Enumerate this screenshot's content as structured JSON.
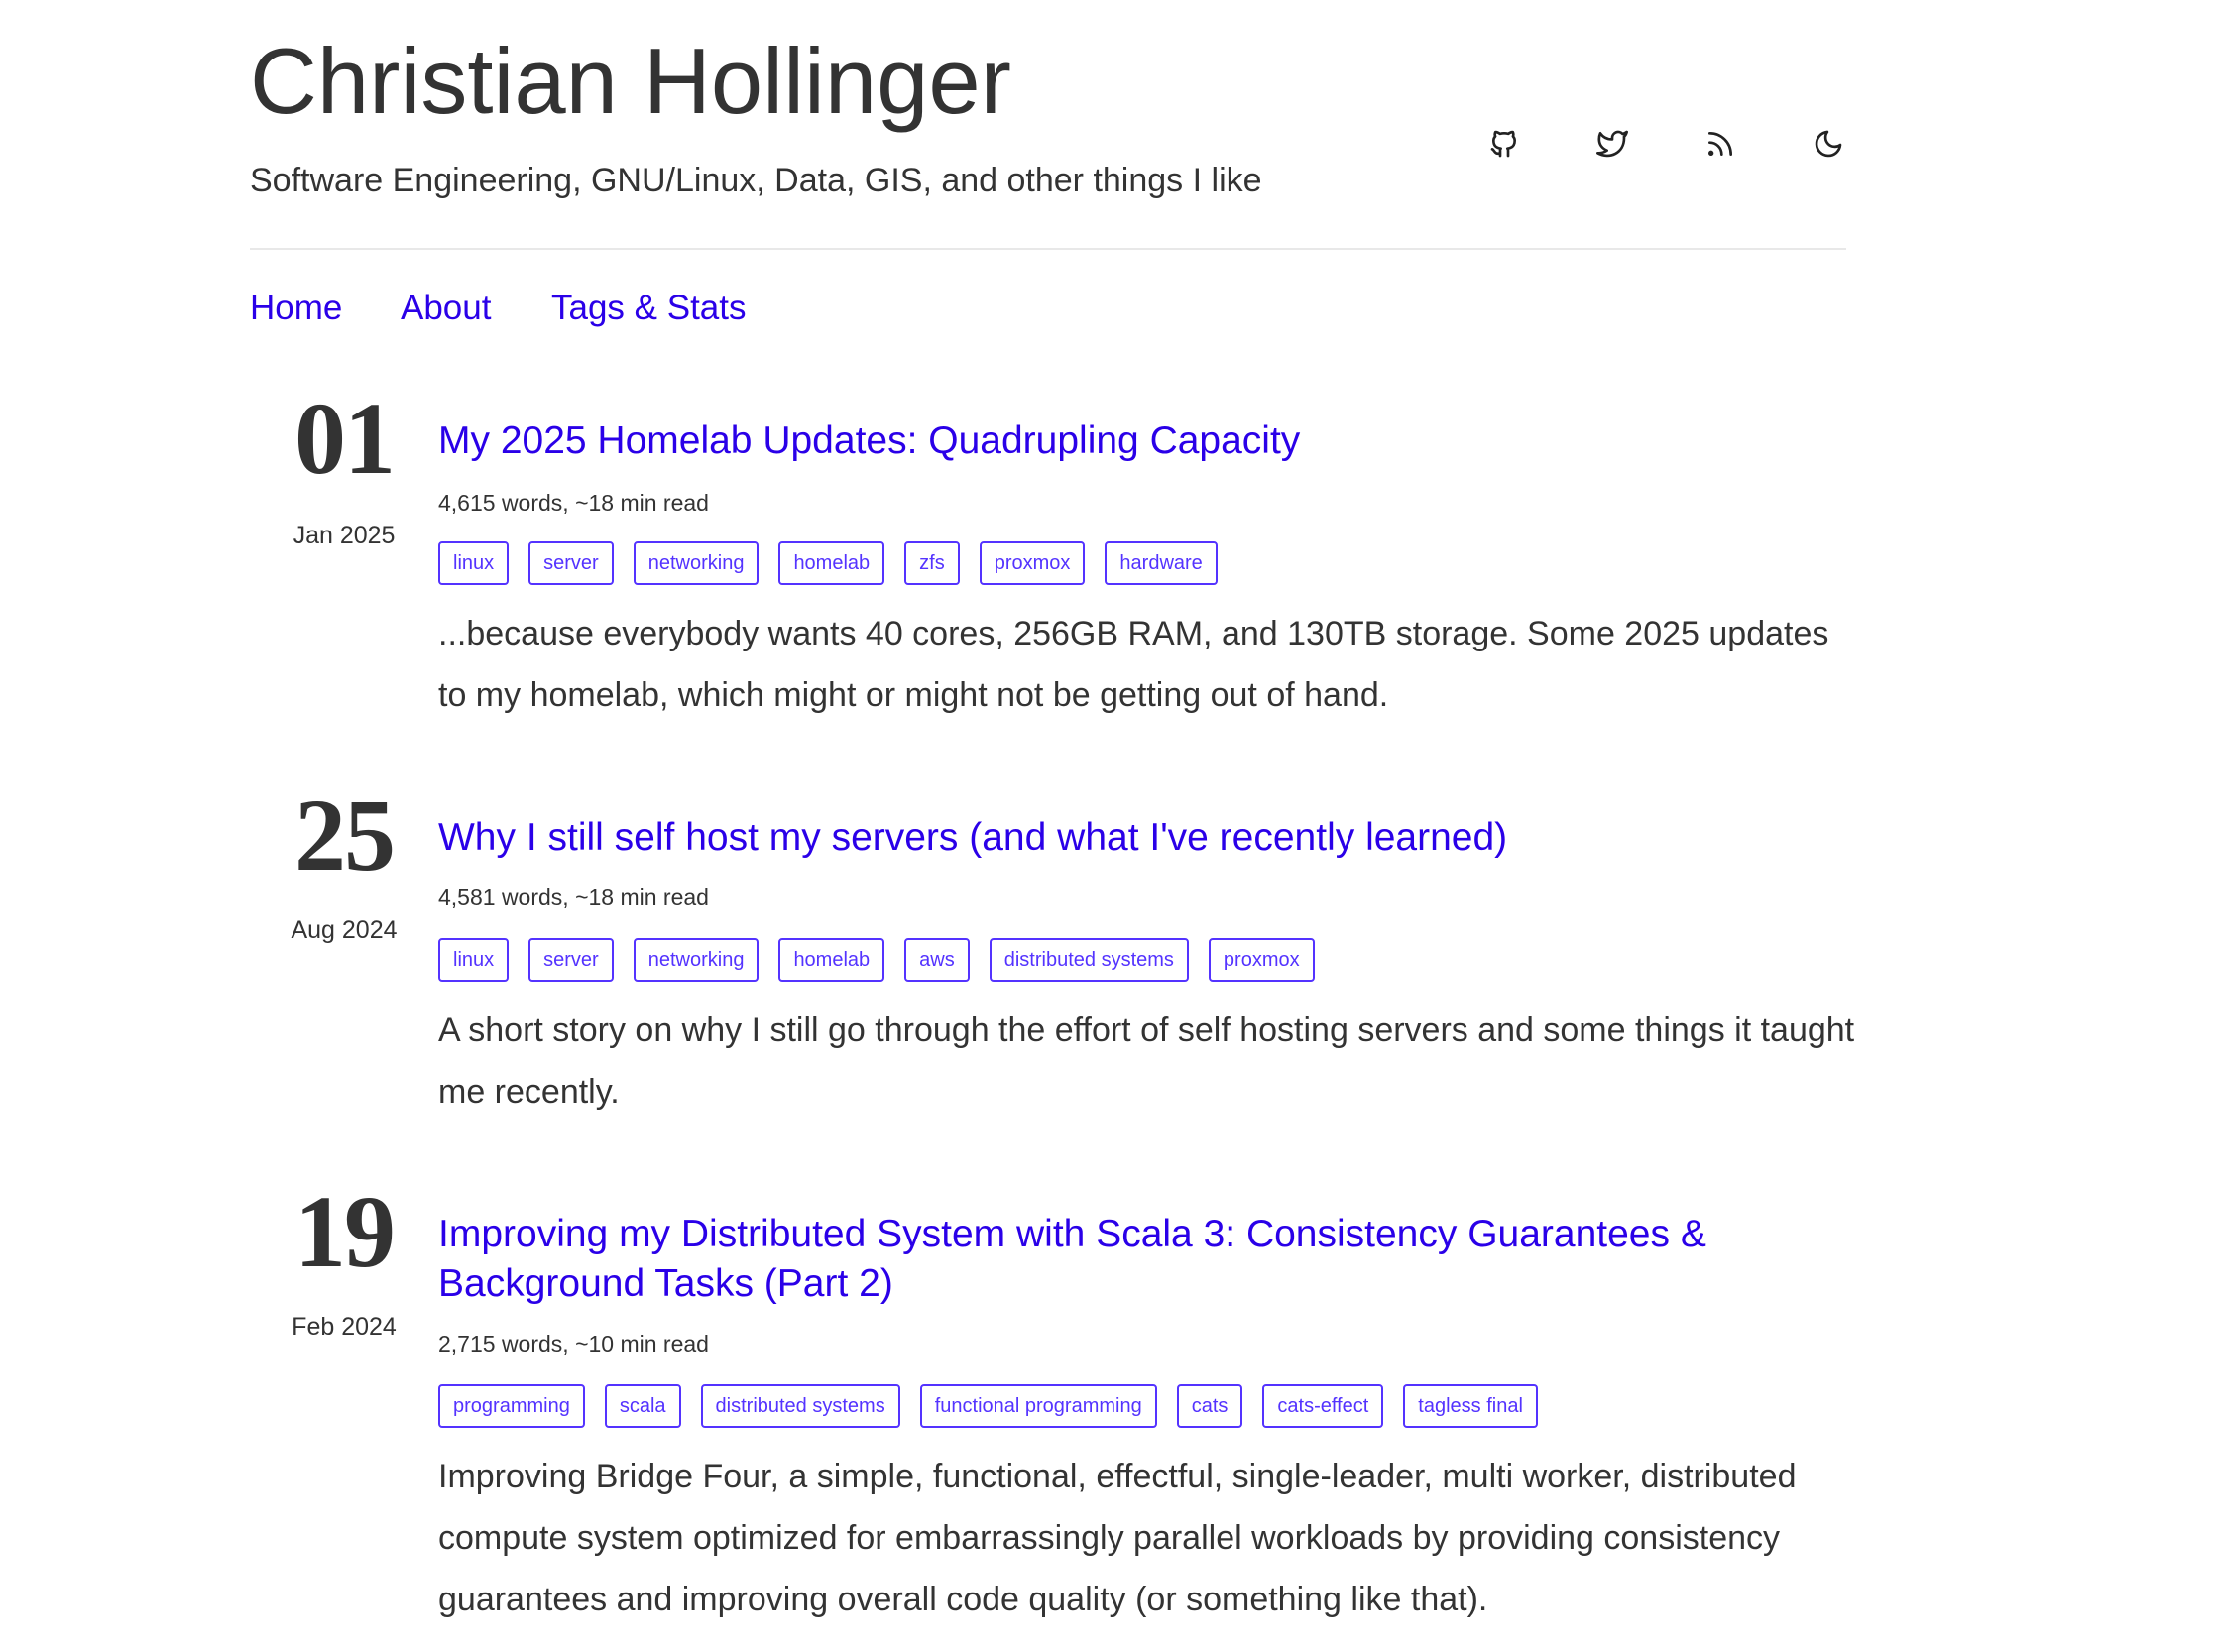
{
  "header": {
    "title": "Christian Hollinger",
    "subtitle": "Software Engineering, GNU/Linux, Data, GIS, and other things I like",
    "icons": [
      "github-icon",
      "twitter-icon",
      "rss-icon",
      "dark-mode-icon"
    ]
  },
  "nav": {
    "home": "Home",
    "about": "About",
    "tags_stats": "Tags & Stats"
  },
  "posts": [
    {
      "day": "01",
      "month": "Jan 2025",
      "title": "My 2025 Homelab Updates: Quadrupling Capacity",
      "meta": "4,615 words, ~18 min read",
      "tags": [
        "linux",
        "server",
        "networking",
        "homelab",
        "zfs",
        "proxmox",
        "hardware"
      ],
      "excerpt": "...because everybody wants 40 cores, 256GB RAM, and 130TB storage. Some 2025 updates to my homelab, which might or might not be getting out of hand."
    },
    {
      "day": "25",
      "month": "Aug 2024",
      "title": "Why I still self host my servers (and what I've recently learned)",
      "meta": "4,581 words, ~18 min read",
      "tags": [
        "linux",
        "server",
        "networking",
        "homelab",
        "aws",
        "distributed systems",
        "proxmox"
      ],
      "excerpt": "A short story on why I still go through the effort of self hosting servers and some things it taught me recently."
    },
    {
      "day": "19",
      "month": "Feb 2024",
      "title": "Improving my Distributed System with Scala 3: Consistency Guarantees & Background Tasks (Part 2)",
      "meta": "2,715 words, ~10 min read",
      "tags": [
        "programming",
        "scala",
        "distributed systems",
        "functional programming",
        "cats",
        "cats-effect",
        "tagless final"
      ],
      "excerpt": "Improving Bridge Four, a simple, functional, effectful, single-leader, multi worker, distributed compute system optimized for embarrassingly parallel workloads by providing consistency guarantees and improving overall code quality (or something like that)."
    }
  ],
  "colors": {
    "link": "#2a00e8",
    "tag": "#5433ff",
    "text": "#333333",
    "divider": "#e8e8e8"
  }
}
